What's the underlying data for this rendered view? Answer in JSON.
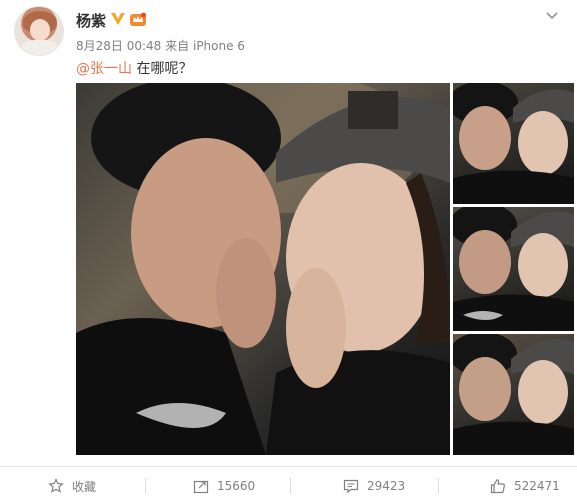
{
  "post": {
    "author": "杨紫",
    "date": "8月28日 00:48",
    "source_prefix": "来自",
    "device": "iPhone 6",
    "mention": "@张一山",
    "text": " 在哪呢？"
  },
  "actions": {
    "favorite_label": "收藏",
    "repost_count": "15660",
    "comment_count": "29423",
    "like_count": "522471"
  },
  "colors": {
    "mention": "#eb7350",
    "verified": "#f5a623",
    "meta_gray": "#808080"
  },
  "icons": [
    "verified-icon",
    "vip-crown-icon",
    "chevron-down-icon",
    "star-icon",
    "repost-icon",
    "comment-icon",
    "like-icon"
  ]
}
